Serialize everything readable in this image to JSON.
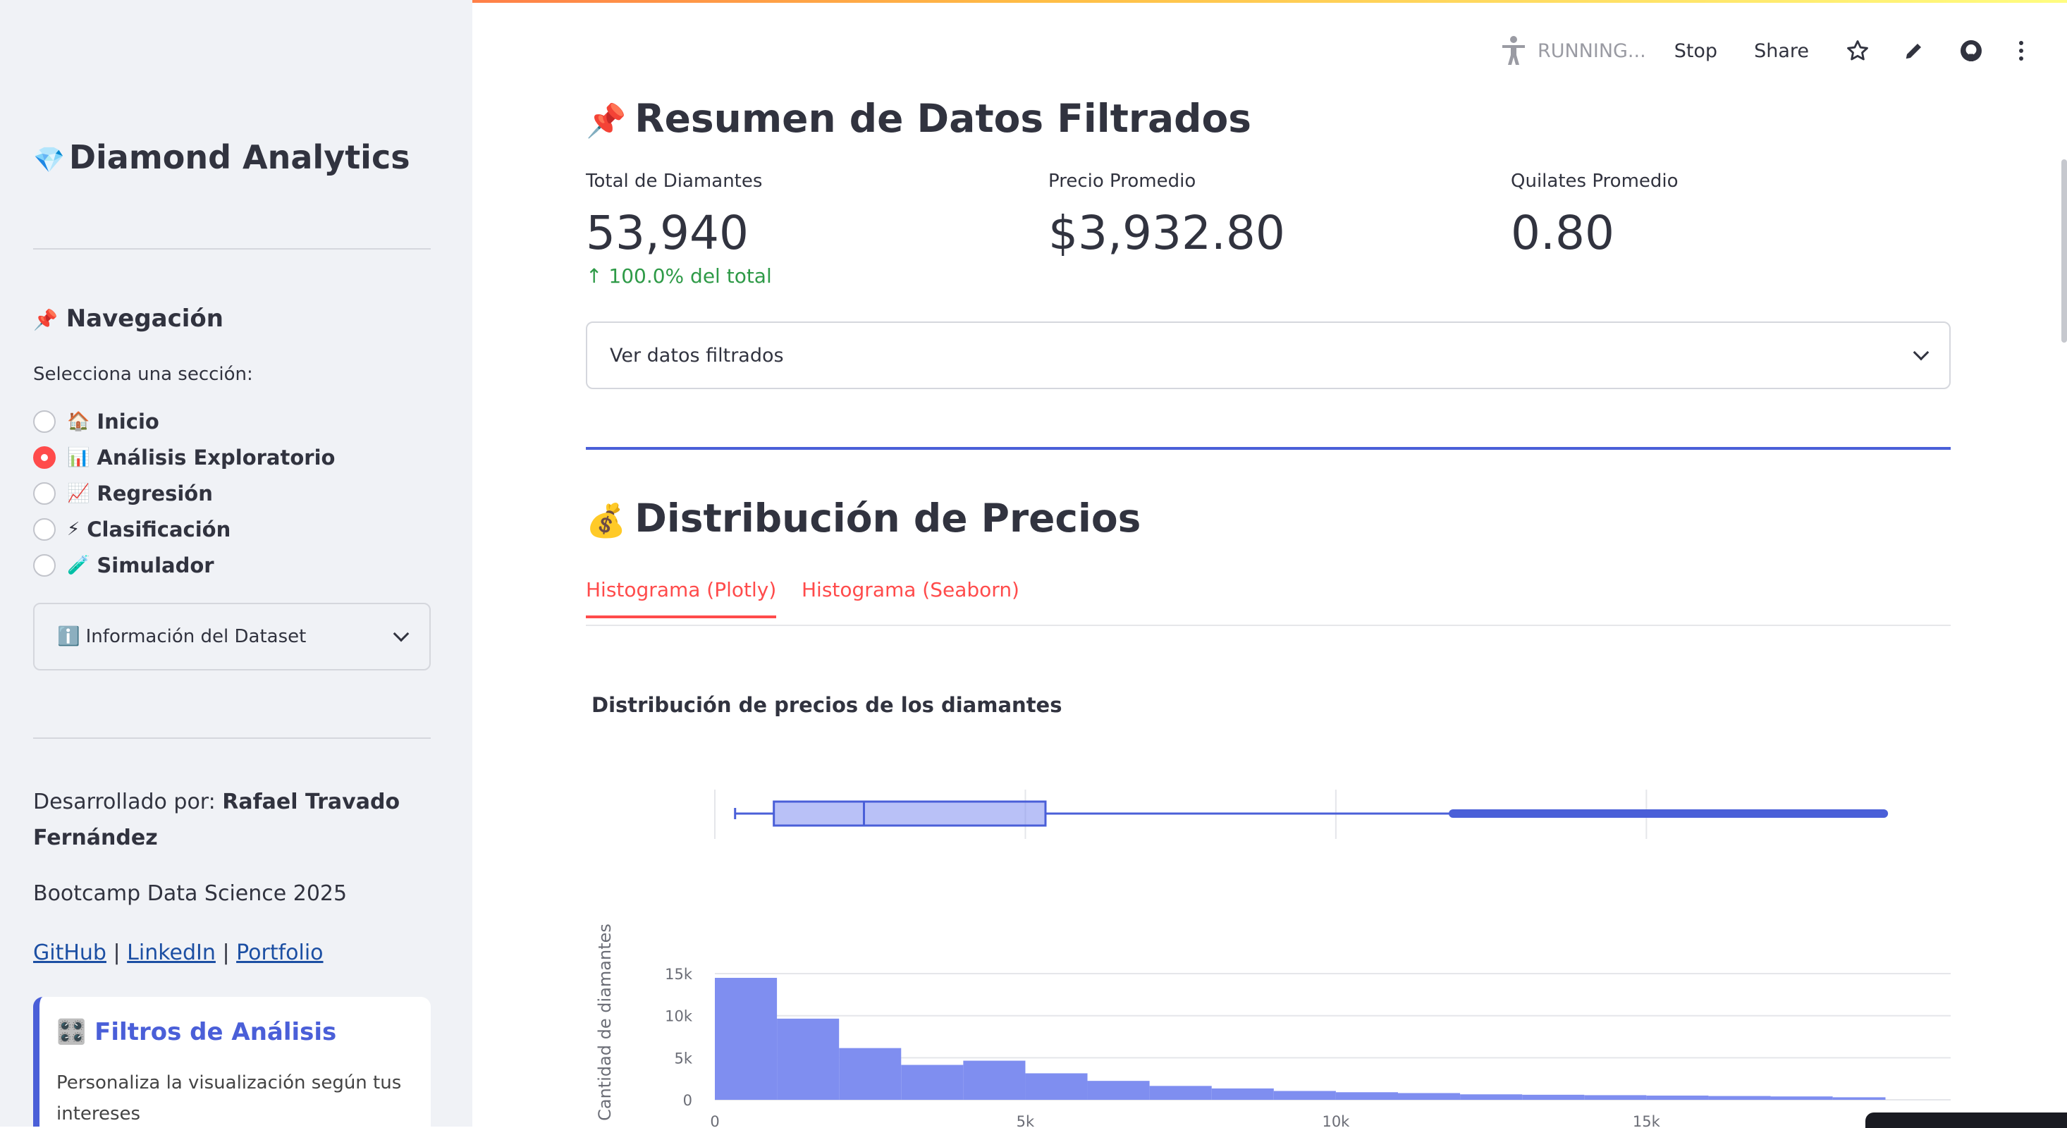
{
  "header": {
    "status": "RUNNING...",
    "stop": "Stop",
    "share": "Share"
  },
  "sidebar": {
    "app_icon": "💎",
    "app_title": "Diamond Analytics",
    "nav_icon": "📌",
    "nav_title": "Navegación",
    "nav_prompt": "Selecciona una sección:",
    "items": [
      {
        "icon": "🏠",
        "label": "Inicio",
        "selected": false
      },
      {
        "icon": "📊",
        "label": "Análisis Exploratorio",
        "selected": true
      },
      {
        "icon": "📈",
        "label": "Regresión",
        "selected": false
      },
      {
        "icon": "⚡",
        "label": "Clasificación",
        "selected": false
      },
      {
        "icon": "🧪",
        "label": "Simulador",
        "selected": false
      }
    ],
    "dataset_info": "ℹ️ Información del Dataset",
    "dev_prefix": "Desarrollado por: ",
    "dev_name": "Rafael Travado Fernández",
    "bootcamp": "Bootcamp Data Science 2025",
    "links": [
      "GitHub",
      "LinkedIn",
      "Portfolio"
    ],
    "link_sep": "|",
    "filters_title": "🎛️ Filtros de Análisis",
    "filters_sub": "Personaliza la visualización según tus intereses"
  },
  "summary": {
    "icon": "📌",
    "title": "Resumen de Datos Filtrados",
    "metrics": [
      {
        "label": "Total de Diamantes",
        "value": "53,940",
        "delta": "100.0% del total"
      },
      {
        "label": "Precio Promedio",
        "value": "$3,932.80"
      },
      {
        "label": "Quilates Promedio",
        "value": "0.80"
      }
    ],
    "expander": "Ver datos filtrados"
  },
  "distribution": {
    "icon": "💰",
    "title": "Distribución de Precios",
    "tabs": [
      "Histograma (Plotly)",
      "Histograma (Seaborn)"
    ]
  },
  "colors": {
    "accent": "#ff4b4b",
    "bars": "#7f8ef0",
    "box_line": "#4a5fd8",
    "delta": "#2e9a47"
  },
  "chart_data": {
    "type": "bar",
    "title": "Distribución de precios de los diamantes",
    "ylabel": "Cantidad de diamantes",
    "xlabel": "",
    "bin_width": 1000,
    "x": [
      0,
      1000,
      2000,
      3000,
      4000,
      5000,
      6000,
      7000,
      8000,
      9000,
      10000,
      11000,
      12000,
      13000,
      14000,
      15000,
      16000,
      17000,
      18000
    ],
    "values": [
      14500,
      9650,
      6150,
      4150,
      4650,
      3150,
      2250,
      1650,
      1350,
      1050,
      900,
      800,
      650,
      600,
      550,
      500,
      450,
      400,
      300
    ],
    "xlim": [
      0,
      19900
    ],
    "ylim": [
      0,
      15700
    ],
    "yticks": [
      0,
      5000,
      10000,
      15000
    ],
    "ytick_labels": [
      "0",
      "5k",
      "10k",
      "15k"
    ],
    "xticks": [
      0,
      5000,
      10000,
      15000
    ],
    "xtick_labels": [
      "0",
      "5k",
      "10k",
      "15k"
    ],
    "boxplot": {
      "min": 326,
      "q1": 950,
      "median": 2401,
      "q3": 5324,
      "upper_fence": 11886,
      "max": 18823
    }
  }
}
